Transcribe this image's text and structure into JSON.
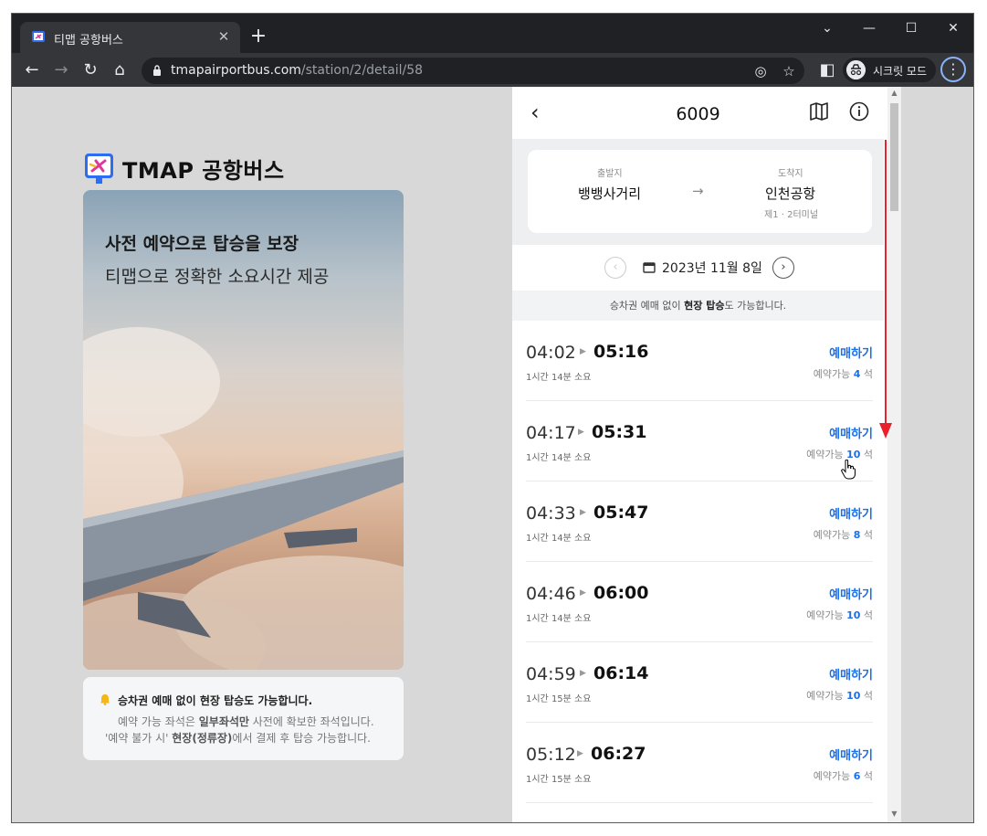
{
  "browser": {
    "tab_title": "티맵 공항버스",
    "tab_close": "✕",
    "new_tab": "+",
    "url_host": "tmapairportbus.com",
    "url_path": "/station/2/detail/58",
    "incognito_label": "시크릿 모드",
    "accent_color": "#8ab4f8"
  },
  "brand": {
    "wordmark": "TMAP 공항버스",
    "hero_title": "사전 예약으로 탑승을 보장",
    "hero_subtitle": "티맵으로 정확한 소요시간 제공"
  },
  "notice": {
    "title": "승차권 예매 없이 현장 탑승도 가능합니다.",
    "line1_a": "예약 가능 좌석은 ",
    "line1_b": "일부좌석만",
    "line1_c": " 사전에 확보한 좌석입니다.",
    "line2_a": "'예약 불가 시' ",
    "line2_b": "현장(정류장)",
    "line2_c": "에서 결제 후 탑승 가능합니다."
  },
  "route": {
    "number": "6009",
    "origin_caption": "출발지",
    "origin": "뱅뱅사거리",
    "dest_caption": "도착지",
    "dest": "인천공항",
    "dest_sub": "제1 · 2터미널",
    "arrow": "→"
  },
  "date": {
    "label": "2023년 11월 8일",
    "prev": "‹",
    "next": "›"
  },
  "onsite": {
    "prefix": "승차권 예매 없이 ",
    "bold": "현장 탑승",
    "suffix": "도 가능합니다."
  },
  "schedule": [
    {
      "dep": "04:02",
      "arr": "05:16",
      "dur": "1시간 14분 소요",
      "book": "예매하기",
      "avail_prefix": "예약가능 ",
      "seats": "4",
      "avail_suffix": " 석"
    },
    {
      "dep": "04:17",
      "arr": "05:31",
      "dur": "1시간 14분 소요",
      "book": "예매하기",
      "avail_prefix": "예약가능 ",
      "seats": "10",
      "avail_suffix": " 석"
    },
    {
      "dep": "04:33",
      "arr": "05:47",
      "dur": "1시간 14분 소요",
      "book": "예매하기",
      "avail_prefix": "예약가능 ",
      "seats": "8",
      "avail_suffix": " 석"
    },
    {
      "dep": "04:46",
      "arr": "06:00",
      "dur": "1시간 14분 소요",
      "book": "예매하기",
      "avail_prefix": "예약가능 ",
      "seats": "10",
      "avail_suffix": " 석"
    },
    {
      "dep": "04:59",
      "arr": "06:14",
      "dur": "1시간 15분 소요",
      "book": "예매하기",
      "avail_prefix": "예약가능 ",
      "seats": "10",
      "avail_suffix": " 석"
    },
    {
      "dep": "05:12",
      "arr": "06:27",
      "dur": "1시간 15분 소요",
      "book": "예매하기",
      "avail_prefix": "예약가능 ",
      "seats": "6",
      "avail_suffix": " 석"
    }
  ],
  "colors": {
    "link_blue": "#1b6fe8",
    "annotation_red": "#e8212a"
  }
}
